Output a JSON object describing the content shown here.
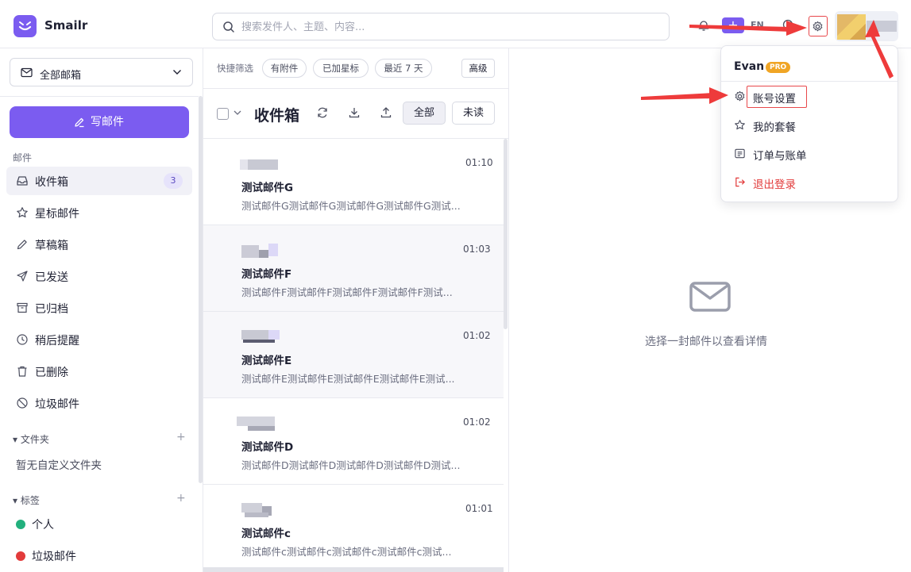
{
  "app": {
    "name": "Smailr"
  },
  "search": {
    "placeholder": "搜索发件人、主题、内容..."
  },
  "topbar": {
    "lang": "EN",
    "plus": "+"
  },
  "sidebar": {
    "mailbox_select": "全部邮箱",
    "compose": "写邮件",
    "mail_section": "邮件",
    "items": [
      {
        "label": "收件箱",
        "badge": "3",
        "icon": "inbox-icon"
      },
      {
        "label": "星标邮件",
        "icon": "star-icon"
      },
      {
        "label": "草稿箱",
        "icon": "pencil-icon"
      },
      {
        "label": "已发送",
        "icon": "send-icon"
      },
      {
        "label": "已归档",
        "icon": "archive-icon"
      },
      {
        "label": "稍后提醒",
        "icon": "clock-icon"
      },
      {
        "label": "已删除",
        "icon": "trash-icon"
      },
      {
        "label": "垃圾邮件",
        "icon": "block-icon"
      }
    ],
    "folders_head": "▾ 文件夹",
    "folders_empty": "暂无自定义文件夹",
    "tags_head": "▾ 标签",
    "plus": "+",
    "tags": [
      {
        "label": "个人",
        "color": "#22b07d"
      },
      {
        "label": "垃圾邮件",
        "color": "#e23b3b"
      }
    ]
  },
  "list": {
    "quick_label": "快捷筛选",
    "chips": [
      "有附件",
      "已加星标",
      "最近 7 天"
    ],
    "advanced": "高级",
    "title": "收件箱",
    "filter_all": "全部",
    "filter_unread": "未读",
    "mails": [
      {
        "time": "01:10",
        "subject": "测试邮件G",
        "preview": "测试邮件G测试邮件G测试邮件G测试邮件G测试..."
      },
      {
        "time": "01:03",
        "subject": "测试邮件F",
        "preview": "测试邮件F测试邮件F测试邮件F测试邮件F测试..."
      },
      {
        "time": "01:02",
        "subject": "测试邮件E",
        "preview": "测试邮件E测试邮件E测试邮件E测试邮件E测试..."
      },
      {
        "time": "01:02",
        "subject": "测试邮件D",
        "preview": "测试邮件D测试邮件D测试邮件D测试邮件D测试..."
      },
      {
        "time": "01:01",
        "subject": "测试邮件c",
        "preview": "测试邮件c测试邮件c测试邮件c测试邮件c测试..."
      }
    ]
  },
  "reader": {
    "hint": "选择一封邮件以查看详情"
  },
  "menu": {
    "user": "Evan",
    "badge": "PRO",
    "items": [
      {
        "label": "账号设置",
        "icon": "gear-icon"
      },
      {
        "label": "我的套餐",
        "icon": "star-icon"
      },
      {
        "label": "订单与账单",
        "icon": "receipt-icon"
      },
      {
        "label": "退出登录",
        "icon": "logout-icon"
      }
    ]
  },
  "colors": {
    "accent": "#7b5cf0",
    "danger": "#e23b3b",
    "annotation": "#ee3b3b"
  }
}
